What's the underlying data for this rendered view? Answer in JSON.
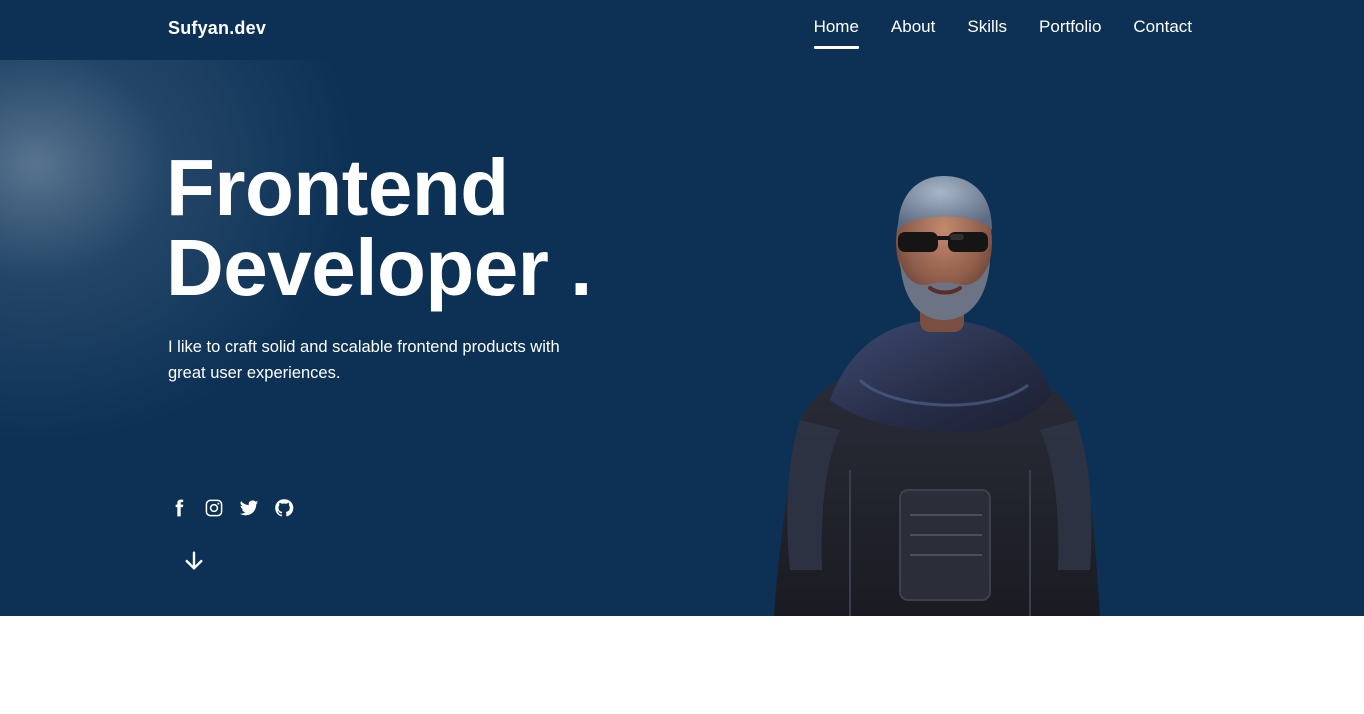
{
  "nav": {
    "brand": "Sufyan.dev",
    "links": [
      {
        "label": "Home",
        "active": true
      },
      {
        "label": "About"
      },
      {
        "label": "Skills"
      },
      {
        "label": "Portfolio"
      },
      {
        "label": "Contact"
      }
    ]
  },
  "hero": {
    "title_line1": "Frontend",
    "title_line2": "Developer .",
    "tagline": "I like to craft solid and scalable frontend products with great user experiences.",
    "socials": [
      {
        "icon": "facebook-icon"
      },
      {
        "icon": "instagram-icon"
      },
      {
        "icon": "twitter-icon"
      },
      {
        "icon": "github-icon"
      }
    ],
    "scroll_icon": "arrow-down-icon",
    "avatar_image": "3d-avatar-man-with-sunglasses"
  },
  "colors": {
    "hero_bg": "#0c3155",
    "text": "#ffffff",
    "page_bg": "#ffffff"
  }
}
